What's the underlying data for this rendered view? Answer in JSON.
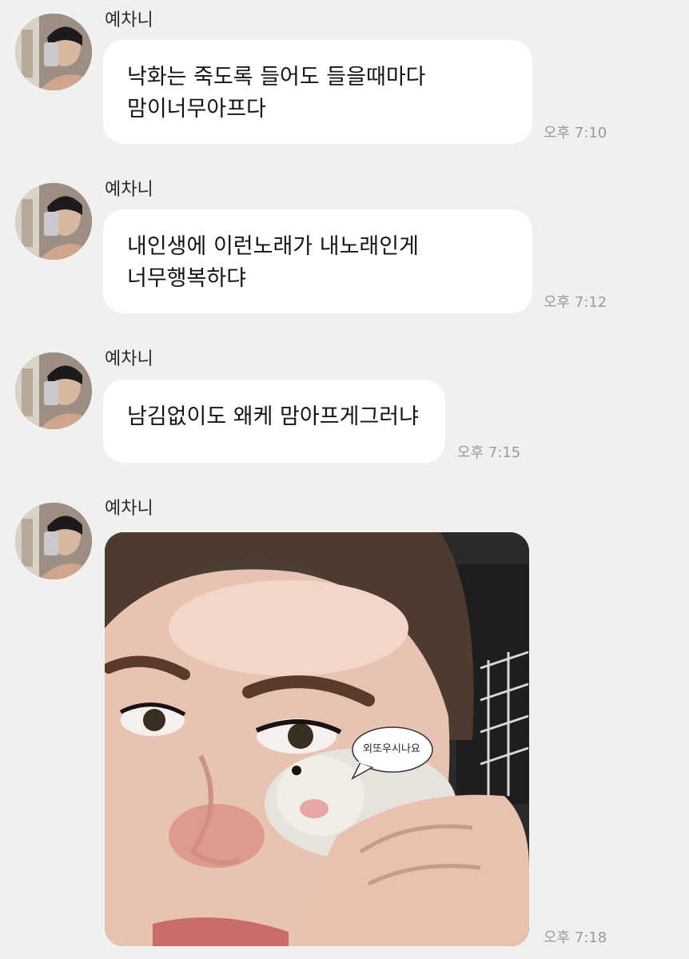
{
  "messages": [
    {
      "sender": "예차니",
      "lines": [
        "낙화는 죽도록 들어도 들을때마다",
        "맘이너무아프다"
      ],
      "time": "오후 7:10"
    },
    {
      "sender": "예차니",
      "lines": [
        "내인생에 이런노래가 내노래인게",
        "너무행복하댜"
      ],
      "time": "오후 7:12"
    },
    {
      "sender": "예차니",
      "lines": [
        "남김없이도 왜케 맘아프게그러냐"
      ],
      "time": "오후 7:15"
    },
    {
      "sender": "예차니",
      "image_caption": "외또우시나요",
      "time": "오후 7:18"
    }
  ],
  "colors": {
    "background": "#f0f0f0",
    "bubble": "#ffffff",
    "timestamp": "#9a9a9a"
  }
}
